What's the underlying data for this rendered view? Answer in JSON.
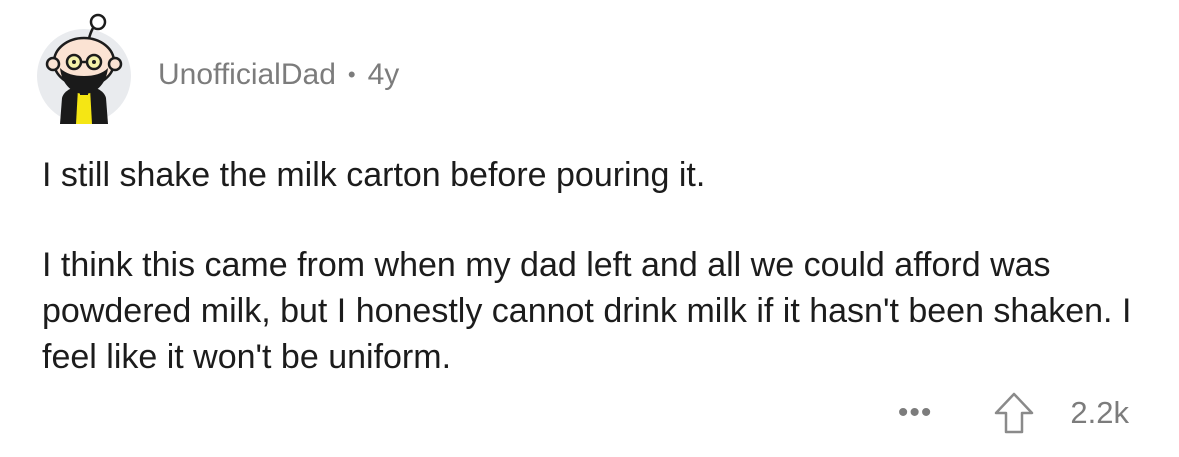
{
  "comment": {
    "author": "UnofficialDad",
    "separator": "•",
    "age": "4y",
    "paragraphs": [
      "I still shake the milk carton before pouring it.",
      "I think this came from when my dad left and all we could afford was powdered milk, but I honestly cannot drink milk if it hasn't been shaken. I feel like it won't be uniform."
    ],
    "more_label": "•••",
    "score": "2.2k",
    "icons": {
      "avatar": "snoo-avatar-bald-beard-glasses",
      "upvote": "upvote-arrow-icon"
    },
    "colors": {
      "meta_text": "#7c7c7c",
      "body_text": "#1c1c1c",
      "avatar_bg": "#e9ebee",
      "avatar_vest": "#f5e614"
    }
  }
}
